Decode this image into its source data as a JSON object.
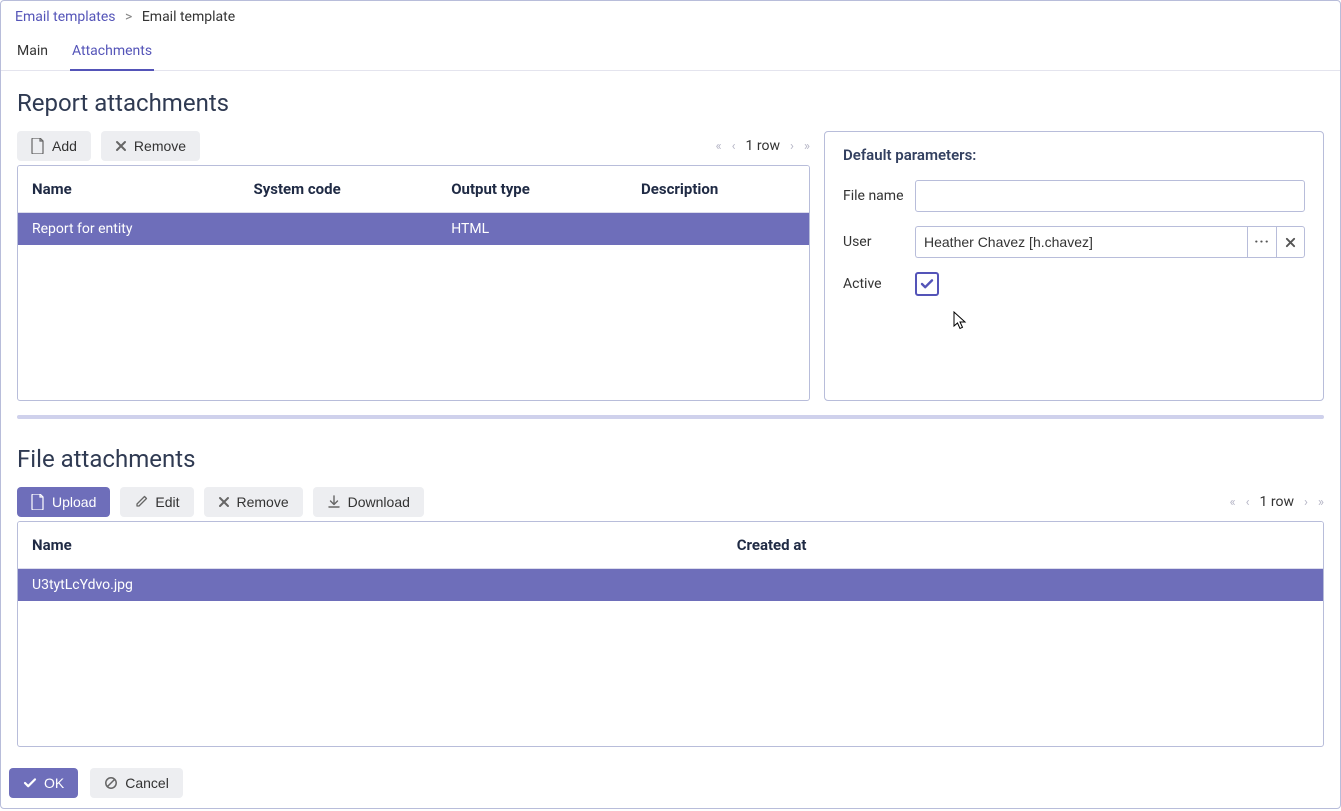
{
  "breadcrumb": {
    "parent": "Email templates",
    "current": "Email template"
  },
  "tabs": {
    "main": "Main",
    "attachments": "Attachments"
  },
  "report_section": {
    "title": "Report attachments",
    "add_label": "Add",
    "remove_label": "Remove",
    "pager_text": "1 row",
    "columns": {
      "name": "Name",
      "system_code": "System code",
      "output_type": "Output type",
      "description": "Description"
    },
    "rows": [
      {
        "name": "Report for entity",
        "system_code": "",
        "output_type": "HTML",
        "description": ""
      }
    ]
  },
  "params": {
    "title": "Default parameters:",
    "file_name_label": "File name",
    "file_name_value": "",
    "user_label": "User",
    "user_value": "Heather Chavez [h.chavez]",
    "active_label": "Active",
    "active_checked": true
  },
  "file_section": {
    "title": "File attachments",
    "upload_label": "Upload",
    "edit_label": "Edit",
    "remove_label": "Remove",
    "download_label": "Download",
    "pager_text": "1 row",
    "columns": {
      "name": "Name",
      "created_at": "Created at"
    },
    "rows": [
      {
        "name": "U3tytLcYdvo.jpg",
        "created_at": ""
      }
    ]
  },
  "footer": {
    "ok_label": "OK",
    "cancel_label": "Cancel"
  }
}
